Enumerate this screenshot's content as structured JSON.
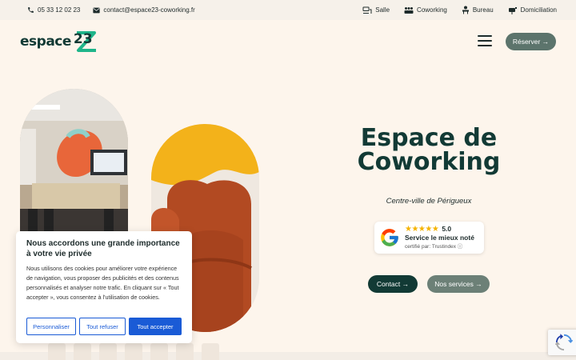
{
  "topbar": {
    "phone": "05 33 12 02 23",
    "email": "contact@espace23-coworking.fr",
    "nav": [
      {
        "label": "Salle",
        "icon": "room-icon"
      },
      {
        "label": "Coworking",
        "icon": "people-icon"
      },
      {
        "label": "Bureau",
        "icon": "office-icon"
      },
      {
        "label": "Domiciliation",
        "icon": "mailbox-icon"
      }
    ]
  },
  "header": {
    "logo_word": "espace",
    "logo_number": "23",
    "reserve_label": "Réserver →"
  },
  "hero": {
    "title_line1": "Espace de",
    "title_line2": "Coworking",
    "subtitle": "Centre-ville de Périgueux"
  },
  "badge": {
    "stars": "★★★★★",
    "rating": "5.0",
    "label": "Service le mieux noté",
    "certified": "certifié par: Trustindex ⓘ"
  },
  "cta": {
    "contact_label": "Contact →",
    "services_label": "Nos services →"
  },
  "cookie": {
    "title": "Nous accordons une grande importance à votre vie privée",
    "body": "Nous utilisons des cookies pour améliorer votre expérience de navigation, vous proposer des publicités et des contenus personnalisés et analyser notre trafic. En cliquant sur « Tout accepter », vous consentez à l'utilisation de cookies.",
    "customize_label": "Personnaliser",
    "reject_label": "Tout refuser",
    "accept_label": "Tout accepter"
  },
  "colors": {
    "brand_dark": "#123a35",
    "brand_green": "#1fb58a",
    "sage": "#5c746c",
    "cookie_blue": "#1a5bd6",
    "page_bg": "#fdf5ec"
  }
}
